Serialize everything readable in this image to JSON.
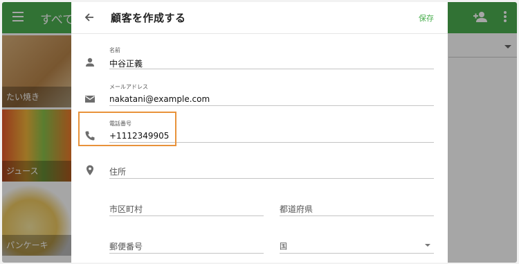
{
  "background_app": {
    "title": "すべて",
    "tiles": [
      {
        "label": "たい焼き"
      },
      {
        "label": "ジュース"
      },
      {
        "label": "パンケーキ"
      }
    ]
  },
  "dialog": {
    "title": "顧客を作成する",
    "save_label": "保存",
    "fields": {
      "name": {
        "label": "名前",
        "value": "中谷正義"
      },
      "email": {
        "label": "メールアドレス",
        "value": "nakatani@example.com"
      },
      "phone": {
        "label": "電話番号",
        "value": "+1112349905"
      },
      "address": {
        "placeholder": "住所"
      },
      "city": {
        "placeholder": "市区町村"
      },
      "prefecture": {
        "placeholder": "都道府県"
      },
      "postal": {
        "placeholder": "郵便番号"
      },
      "country": {
        "placeholder": "国"
      }
    }
  },
  "colors": {
    "accent": "#4caf50",
    "highlight": "#e8923a"
  },
  "icons": {
    "back": "arrow-left-icon",
    "name": "person-icon",
    "email": "mail-icon",
    "phone": "phone-icon",
    "address": "location-pin-icon",
    "header_add": "add-person-icon",
    "header_more": "more-vert-icon"
  }
}
